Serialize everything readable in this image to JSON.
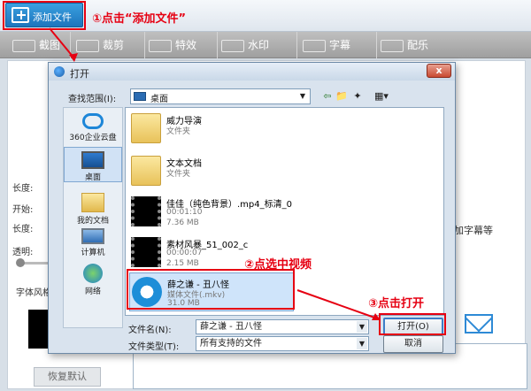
{
  "app": {
    "add_file_label": "添加文件",
    "tabs": [
      "截图",
      "裁剪",
      "特效",
      "水印",
      "字幕",
      "配乐"
    ],
    "left_labels": [
      "长度:",
      "开始:",
      "长度:",
      "透明:",
      "字体风格"
    ],
    "restore_label": "恢复默认",
    "subtitle_hint": "加字幕等"
  },
  "dialog": {
    "title": "打开",
    "close_label": "x",
    "lookin_label": "查找范围(I):",
    "lookin_value": "桌面",
    "toolbar_icons": [
      "back-arrow-icon",
      "up-folder-icon",
      "new-folder-icon",
      "view-menu-icon"
    ],
    "places": [
      {
        "label": "360企业云盘",
        "icon": "cloud-icon"
      },
      {
        "label": "桌面",
        "icon": "desktop-icon"
      },
      {
        "label": "我的文档",
        "icon": "documents-icon"
      },
      {
        "label": "计算机",
        "icon": "computer-icon"
      },
      {
        "label": "网络",
        "icon": "network-icon"
      }
    ],
    "files": [
      {
        "name": "威力导演",
        "sub1": "文件夹",
        "sub2": "",
        "icon": "folder-icon"
      },
      {
        "name": "文本文档",
        "sub1": "文件夹",
        "sub2": "",
        "icon": "folder-icon"
      },
      {
        "name": "佳佳（纯色背景）.mp4_标清_0",
        "sub1": "00:01:10",
        "sub2": "7.36 MB",
        "icon": "video-thumb-icon"
      },
      {
        "name": "素材风暴_51_002_c",
        "sub1": "00:00:07",
        "sub2": "2.15 MB",
        "icon": "video-thumb-icon"
      },
      {
        "name": "薛之谦 - 丑八怪",
        "sub1": "媒体文件(.mkv)",
        "sub2": "31.0 MB",
        "icon": "media-player-icon"
      }
    ],
    "filename_label": "文件名(N):",
    "filename_value": "薛之谦 - 丑八怪",
    "filetype_label": "文件类型(T):",
    "filetype_value": "所有支持的文件",
    "open_button": "打开(O)",
    "cancel_button": "取消"
  },
  "annotations": {
    "step1": "①点击“添加文件”",
    "step2": "②点选中视频",
    "step3": "③点击打开"
  },
  "colors": {
    "annotation": "#e60012",
    "accent": "#1d75bd"
  }
}
